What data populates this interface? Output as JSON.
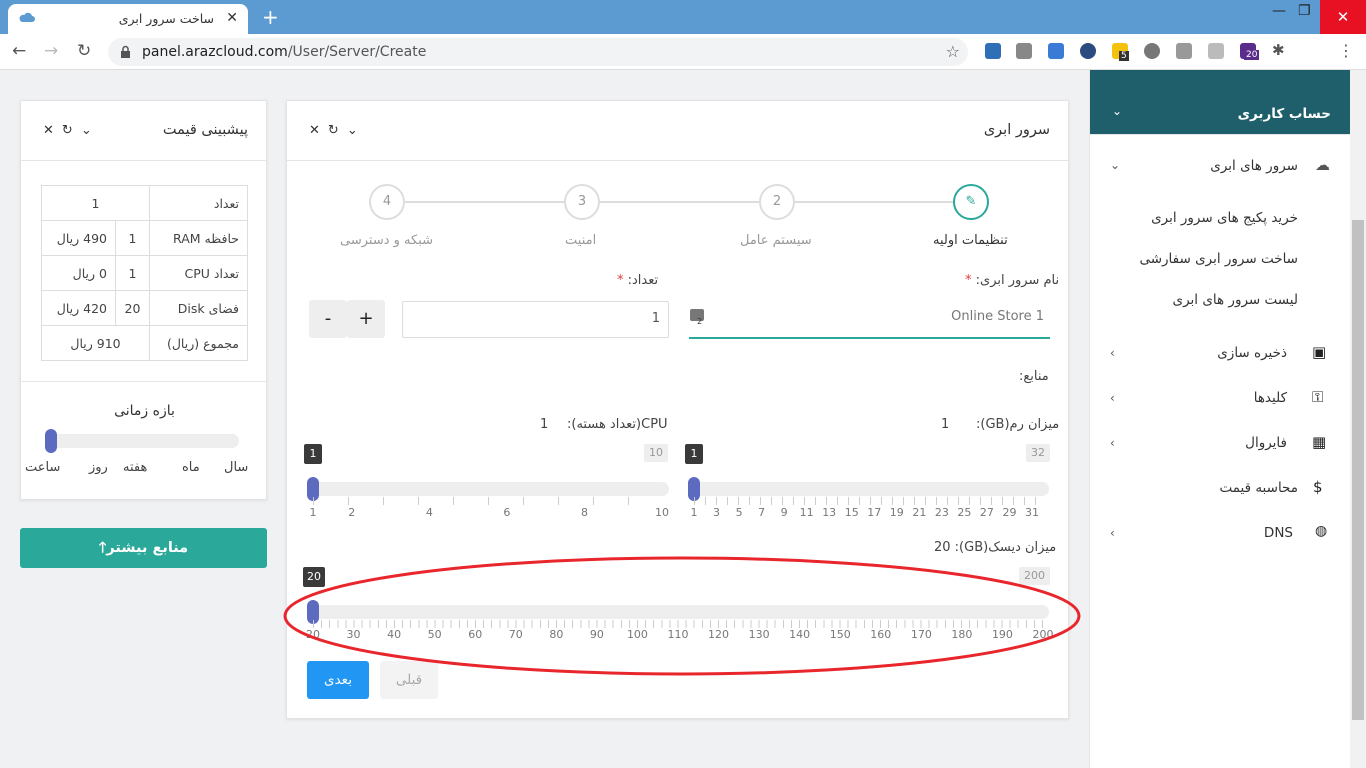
{
  "browser": {
    "tab_title": "ساخت سرور ابری",
    "url_domain": "panel.arazcloud.com",
    "url_path": "/User/Server/Create",
    "ext_badge_1": "5",
    "ext_badge_2": "20"
  },
  "price_card": {
    "title": "پیشبینی قیمت",
    "rows": [
      {
        "label": "تعداد",
        "qty": "",
        "price": "1"
      },
      {
        "label": "حافظه RAM",
        "qty": "1",
        "price": "490 ریال"
      },
      {
        "label": "تعداد CPU",
        "qty": "1",
        "price": "0 ریال"
      },
      {
        "label": "فضای Disk",
        "qty": "20",
        "price": "420 ریال"
      },
      {
        "label": "مجموع (ریال)",
        "qty": "",
        "price": "910 ریال"
      }
    ],
    "period_title": "بازه زمانی",
    "period_options": [
      "سال",
      "ماه",
      "هفته",
      "روز",
      "ساعت"
    ],
    "more_resources_button": "منابع بیشتر🡑"
  },
  "server_card": {
    "title": "سرور ابری",
    "steps": [
      {
        "num": "",
        "label": "تنظیمات اولیه"
      },
      {
        "num": "2",
        "label": "سیستم عامل"
      },
      {
        "num": "3",
        "label": "امنیت"
      },
      {
        "num": "4",
        "label": "شبکه و دسترسی"
      }
    ],
    "name_label": "نام سرور ابری:",
    "name_value": "Online Store 1",
    "count_label": "تعداد:",
    "count_value": "1",
    "plus": "+",
    "minus": "-",
    "resources_label": "منابع:",
    "ram_label": "میزان رم(GB):",
    "ram_value": "1",
    "ram_max": "32",
    "ram_ticks": [
      "1",
      "3",
      "5",
      "7",
      "9",
      "11",
      "13",
      "15",
      "17",
      "19",
      "21",
      "23",
      "25",
      "27",
      "29",
      "31"
    ],
    "cpu_label": "CPU(تعداد هسته):",
    "cpu_value": "1",
    "cpu_max": "10",
    "cpu_ticks": [
      "1",
      "2",
      "4",
      "6",
      "8",
      "10"
    ],
    "disk_label": "میزان دیسک(GB): 20",
    "disk_value": "20",
    "disk_max": "200",
    "disk_ticks": [
      "20",
      "30",
      "40",
      "50",
      "60",
      "70",
      "80",
      "90",
      "100",
      "110",
      "120",
      "130",
      "140",
      "150",
      "160",
      "170",
      "180",
      "190",
      "200"
    ],
    "next_button": "بعدی",
    "prev_button": "قبلی"
  },
  "sidebar": {
    "account": "حساب کاربری",
    "cloud_servers": "سرور های ابری",
    "sub_items": [
      "خرید پکیج های سرور ابری",
      "ساخت سرور ابری سفارشی",
      "لیست سرور های ابری"
    ],
    "items": [
      "ذخیره سازی",
      "کلیدها",
      "فایروال",
      "محاسبه قیمت",
      "DNS"
    ]
  },
  "colors": {
    "accent": "#2aa89a",
    "primary": "#2196f3",
    "annotation": "#e8262b",
    "slider": "#5c6bc0"
  }
}
